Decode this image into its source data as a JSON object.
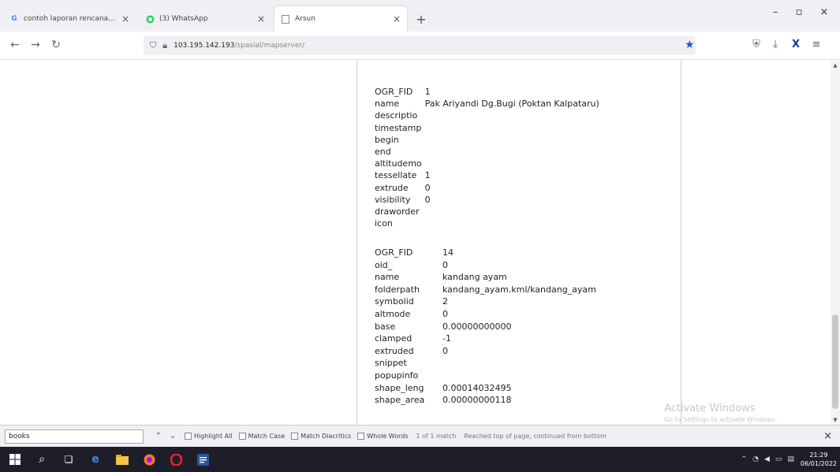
{
  "browser": {
    "tabs": [
      {
        "title": "contoh laporan rencana kerja - W",
        "favicon": "google-icon",
        "active": false
      },
      {
        "title": "(3) WhatsApp",
        "favicon": "whatsapp-icon",
        "active": false
      },
      {
        "title": "Arsun",
        "favicon": "page-icon",
        "active": true
      }
    ],
    "url_host": "103.195.142.193",
    "url_path": "/spasial/mapserver/"
  },
  "features": [
    {
      "rows": [
        {
          "k": "OGR_FID",
          "v": "1"
        },
        {
          "k": "name",
          "v": "Pak Ariyandi Dg.Bugi (Poktan Kalpataru)"
        },
        {
          "k": "descriptio",
          "v": ""
        },
        {
          "k": "timestamp",
          "v": ""
        },
        {
          "k": "begin",
          "v": ""
        },
        {
          "k": "end",
          "v": ""
        },
        {
          "k": "altitudemo",
          "v": ""
        },
        {
          "k": "tessellate",
          "v": "1"
        },
        {
          "k": "extrude",
          "v": "0"
        },
        {
          "k": "visibility",
          "v": "0"
        },
        {
          "k": "draworder",
          "v": ""
        },
        {
          "k": "icon",
          "v": ""
        }
      ]
    },
    {
      "rows": [
        {
          "k": "OGR_FID",
          "v": "14"
        },
        {
          "k": "oid_",
          "v": "0"
        },
        {
          "k": "name",
          "v": "kandang ayam"
        },
        {
          "k": "folderpath",
          "v": "kandang_ayam.kml/kandang_ayam"
        },
        {
          "k": "symbolid",
          "v": "2"
        },
        {
          "k": "altmode",
          "v": "0"
        },
        {
          "k": "base",
          "v": "0.00000000000"
        },
        {
          "k": "clamped",
          "v": "-1"
        },
        {
          "k": "extruded",
          "v": "0"
        },
        {
          "k": "snippet",
          "v": ""
        },
        {
          "k": "popupinfo",
          "v": ""
        },
        {
          "k": "shape_leng",
          "v": "0.00014032495"
        },
        {
          "k": "shape_area",
          "v": "0.00000000118"
        }
      ]
    }
  ],
  "findbar": {
    "value": "books",
    "highlight_all": "Highlight All",
    "match_case": "Match Case",
    "match_diacritics": "Match Diacritics",
    "whole_words": "Whole Words",
    "count": "1 of 1 match",
    "status": "Reached top of page, continued from bottom"
  },
  "watermark": {
    "title": "Activate Windows",
    "subtitle": "Go to Settings to activate Windows."
  },
  "taskbar": {
    "time": "21:29",
    "date": "06/01/2022"
  },
  "colors": {
    "accent": "#1a5fd1",
    "taskbar": "#1e1e2a"
  }
}
